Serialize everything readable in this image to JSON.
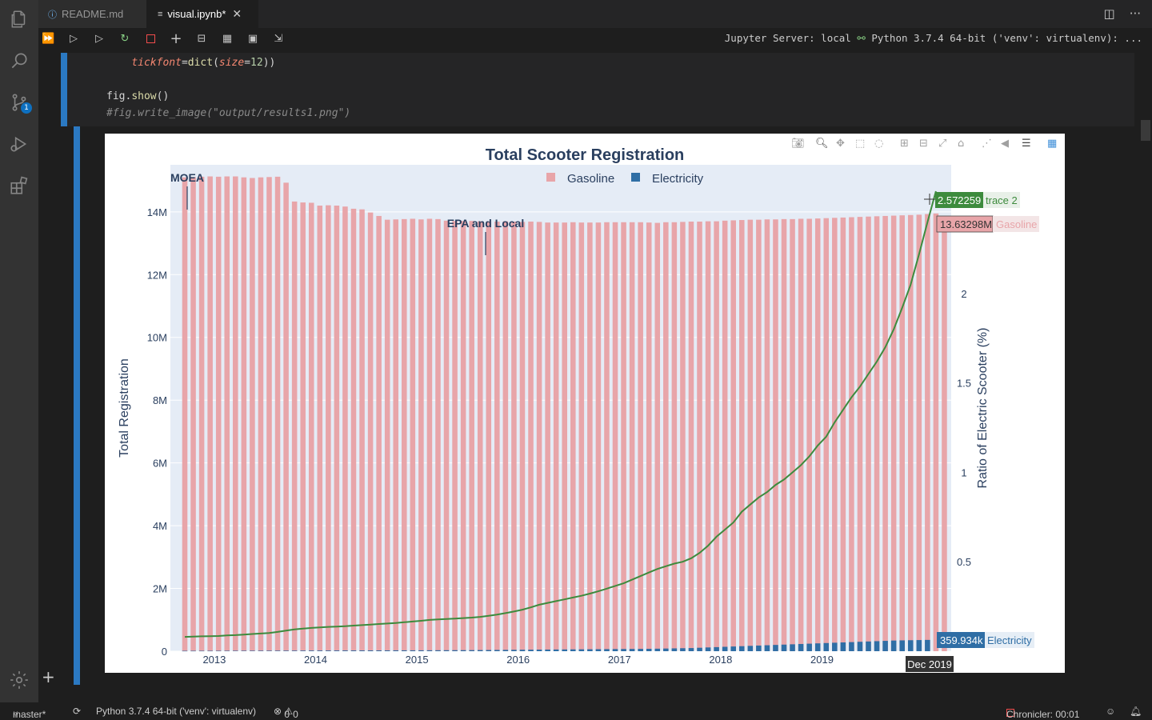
{
  "tabs": [
    {
      "label": "README.md",
      "icon": "info-icon"
    },
    {
      "label": "visual.ipynb*",
      "icon": "notebook-icon"
    }
  ],
  "toolbar": {
    "kernel": "Jupyter Server: local",
    "python": "Python 3.7.4 64-bit ('venv': virtualenv): ..."
  },
  "activity": {
    "scm_badge": "1"
  },
  "code": {
    "line1_param": "tickfont",
    "line1_eq": "=",
    "line1_fn": "dict",
    "line1_open": "(",
    "line1_param2": "size",
    "line1_eq2": "=",
    "line1_num": "12",
    "line1_close": "))",
    "line2_obj": "fig.",
    "line2_meth": "show",
    "line2_call": "()",
    "line3_comment": "#fig.write_image(\"output/results1.png\")"
  },
  "chart_data": {
    "type": "bar",
    "title": "Total Scooter Registration",
    "ylabel": "Total Registration",
    "y2label": "Ratio of Electric Scooter (%)",
    "ylim": [
      0,
      15500000
    ],
    "y2lim": [
      0,
      2.72
    ],
    "yticks": [
      "0",
      "2M",
      "4M",
      "6M",
      "8M",
      "10M",
      "12M",
      "14M"
    ],
    "ytick_values": [
      0,
      2000000,
      4000000,
      6000000,
      8000000,
      10000000,
      12000000,
      14000000
    ],
    "y2ticks": [
      "0.5",
      "1",
      "1.5",
      "2",
      "2.5"
    ],
    "y2tick_values": [
      0.5,
      1,
      1.5,
      2,
      2.5
    ],
    "xticks": [
      "2013",
      "2014",
      "2015",
      "2016",
      "2017",
      "2018",
      "2019"
    ],
    "x_start": "2012-09",
    "x_end": "2019-12",
    "legend": [
      "Gasoline",
      "Electricity"
    ],
    "legend_position": "top-center",
    "colors": {
      "gasoline": "#e8a5a9",
      "electricity": "#2f6ea5",
      "ratio": "#3d8b3d",
      "plot_bg": "#e5ecf6"
    },
    "series": [
      {
        "name": "Gasoline",
        "values": [
          15100000,
          15110000,
          15120000,
          15130000,
          15120000,
          15130000,
          15130000,
          15100000,
          15080000,
          15100000,
          15110000,
          15120000,
          14930000,
          14330000,
          14300000,
          14290000,
          14200000,
          14210000,
          14200000,
          14170000,
          14100000,
          14080000,
          13980000,
          13870000,
          13750000,
          13760000,
          13770000,
          13780000,
          13760000,
          13780000,
          13770000,
          13720000,
          13710000,
          13710000,
          13710000,
          13700000,
          13700000,
          13690000,
          13700000,
          13690000,
          13680000,
          13690000,
          13680000,
          13660000,
          13660000,
          13660000,
          13670000,
          13660000,
          13660000,
          13660000,
          13670000,
          13670000,
          13670000,
          13670000,
          13670000,
          13660000,
          13650000,
          13670000,
          13670000,
          13680000,
          13690000,
          13690000,
          13700000,
          13700000,
          13720000,
          13730000,
          13740000,
          13750000,
          13750000,
          13760000,
          13760000,
          13770000,
          13770000,
          13780000,
          13780000,
          13790000,
          13800000,
          13810000,
          13820000,
          13830000,
          13840000,
          13850000,
          13860000,
          13870000,
          13880000,
          13890000,
          13900000,
          13910000,
          13930000,
          13950000,
          13632980
        ]
      },
      {
        "name": "Electricity",
        "values": [
          12000,
          12500,
          13000,
          13500,
          14000,
          14500,
          15000,
          15500,
          16000,
          16500,
          17000,
          17500,
          18000,
          19000,
          20000,
          21000,
          22000,
          22500,
          23000,
          23500,
          24000,
          24500,
          25000,
          25500,
          26000,
          26500,
          27000,
          27500,
          28000,
          29000,
          30000,
          31000,
          32000,
          33000,
          34000,
          36000,
          38000,
          40000,
          42000,
          44000,
          46000,
          48000,
          50000,
          52000,
          54000,
          56000,
          58000,
          60000,
          62000,
          64000,
          66000,
          68000,
          70000,
          72000,
          74000,
          76000,
          80000,
          85000,
          90000,
          95000,
          100000,
          110000,
          120000,
          130000,
          140000,
          150000,
          160000,
          170000,
          180000,
          190000,
          200000,
          210000,
          220000,
          230000,
          240000,
          250000,
          260000,
          270000,
          280000,
          290000,
          300000,
          310000,
          320000,
          330000,
          340000,
          345000,
          350000,
          355000,
          359934
        ]
      },
      {
        "name": "trace 2",
        "values": [
          0.08,
          0.082,
          0.083,
          0.084,
          0.085,
          0.088,
          0.09,
          0.093,
          0.096,
          0.099,
          0.102,
          0.108,
          0.115,
          0.122,
          0.126,
          0.13,
          0.133,
          0.136,
          0.138,
          0.14,
          0.143,
          0.146,
          0.149,
          0.152,
          0.155,
          0.158,
          0.162,
          0.166,
          0.17,
          0.175,
          0.178,
          0.18,
          0.182,
          0.185,
          0.188,
          0.192,
          0.198,
          0.205,
          0.213,
          0.222,
          0.232,
          0.245,
          0.26,
          0.27,
          0.28,
          0.29,
          0.3,
          0.31,
          0.322,
          0.335,
          0.35,
          0.365,
          0.38,
          0.4,
          0.42,
          0.44,
          0.46,
          0.475,
          0.49,
          0.5,
          0.52,
          0.55,
          0.59,
          0.64,
          0.68,
          0.72,
          0.78,
          0.82,
          0.86,
          0.89,
          0.93,
          0.96,
          1.0,
          1.04,
          1.09,
          1.15,
          1.2,
          1.28,
          1.35,
          1.42,
          1.48,
          1.55,
          1.62,
          1.7,
          1.8,
          1.92,
          2.05,
          2.22,
          2.4,
          2.572259
        ]
      }
    ],
    "annotations": [
      "MOEA",
      "EPA and Local"
    ],
    "hover": {
      "trace2_value": "2.572259",
      "trace2_name": "trace 2",
      "gasoline_value": "13.63298M",
      "gasoline_name": "Gasoline",
      "electricity_value": "359.934k",
      "electricity_name": "Electricity",
      "x_label": "Dec 2019"
    }
  },
  "status": {
    "branch": "master*",
    "python": "Python 3.7.4 64-bit ('venv': virtualenv)",
    "problems": "0",
    "warnings": "0",
    "chronicler": "Chronicler: 00:01"
  }
}
